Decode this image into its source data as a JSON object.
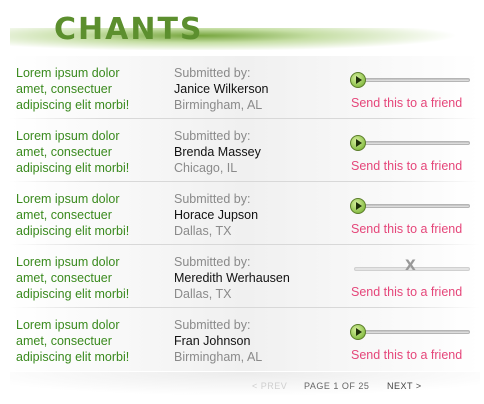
{
  "header": {
    "title": "CHANTS"
  },
  "rows": [
    {
      "chant": [
        "Lorem ipsum dolor",
        "amet, consectuer",
        "adipiscing elit morbi!"
      ],
      "submitted_label": "Submitted by:",
      "name": "Janice Wilkerson",
      "city": "Birmingham, AL",
      "player_available": true,
      "send_label": "Send this to a friend"
    },
    {
      "chant": [
        "Lorem ipsum dolor",
        "amet, consectuer",
        "adipiscing elit morbi!"
      ],
      "submitted_label": "Submitted by:",
      "name": "Brenda Massey",
      "city": "Chicago, IL",
      "player_available": true,
      "send_label": "Send this to a friend"
    },
    {
      "chant": [
        "Lorem ipsum dolor",
        "amet, consectuer",
        "adipiscing elit morbi!"
      ],
      "submitted_label": "Submitted by:",
      "name": "Horace Jupson",
      "city": "Dallas, TX",
      "player_available": true,
      "send_label": "Send this to a friend"
    },
    {
      "chant": [
        "Lorem ipsum dolor",
        "amet, consectuer",
        "adipiscing elit morbi!"
      ],
      "submitted_label": "Submitted by:",
      "name": "Meredith Werhausen",
      "city": "Dallas, TX",
      "player_available": false,
      "unavailable_mark": "X",
      "send_label": "Send this to a friend"
    },
    {
      "chant": [
        "Lorem ipsum dolor",
        "amet, consectuer",
        "adipiscing elit morbi!"
      ],
      "submitted_label": "Submitted by:",
      "name": "Fran Johnson",
      "city": "Birmingham, AL",
      "player_available": true,
      "send_label": "Send this to a friend"
    }
  ],
  "pager": {
    "prev_label": "< PREV",
    "page_info": "PAGE 1 OF 25",
    "next_label": "NEXT >"
  },
  "colors": {
    "title": "#5c8f2e",
    "chant_text": "#3a8a1e",
    "send_link": "#e5467a",
    "play_button": "#8cc04a"
  }
}
